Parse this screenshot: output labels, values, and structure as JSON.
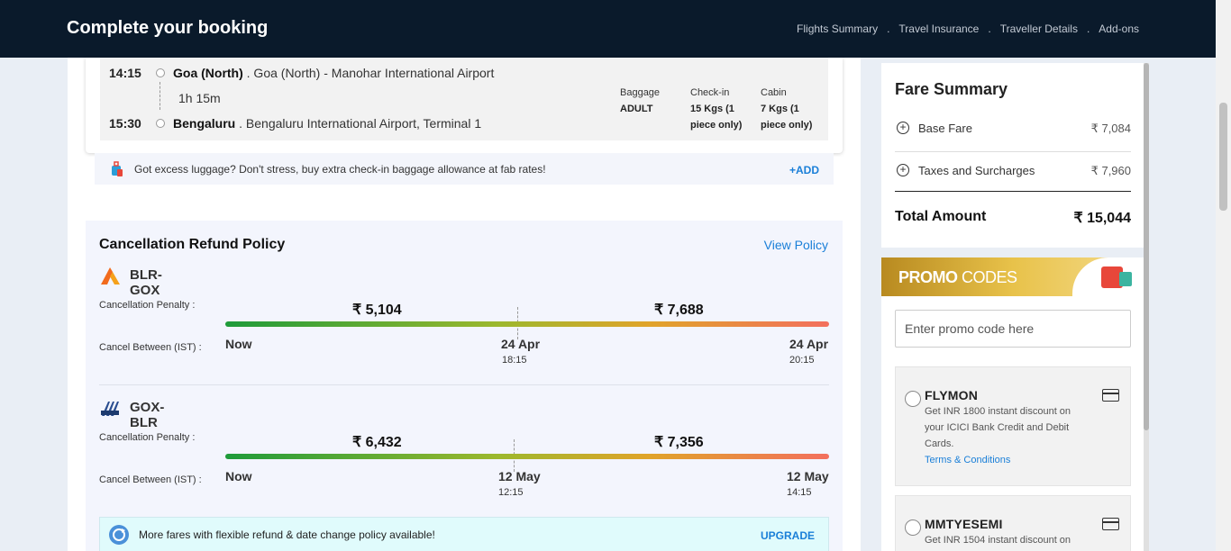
{
  "header": {
    "title": "Complete your booking",
    "steps": [
      "Flights Summary",
      "Travel Insurance",
      "Traveller Details",
      "Add-ons"
    ],
    "separator": "."
  },
  "flight": {
    "depart_time": "14:15",
    "depart_city": "Goa (North)",
    "depart_airport": ". Goa (North) - Manohar International Airport",
    "duration": "1h 15m",
    "arrive_time": "15:30",
    "arrive_city": "Bengaluru",
    "arrive_airport": ". Bengaluru International Airport, Terminal 1",
    "baggage_label": "Baggage",
    "baggage_value": "ADULT",
    "checkin_label": "Check-in",
    "checkin_value": "15 Kgs (1 piece only)",
    "cabin_label": "Cabin",
    "cabin_value": "7 Kgs (1 piece only)"
  },
  "luggage": {
    "text": "Got excess luggage? Don't stress, buy extra check-in baggage allowance at fab rates!",
    "action": "+ADD"
  },
  "cancellation": {
    "title": "Cancellation Refund Policy",
    "view_policy": "View Policy",
    "penalty_label": "Cancellation Penalty :",
    "between_label": "Cancel Between (IST) :",
    "routes": [
      {
        "code": "BLR-GOX",
        "price_1": "₹ 5,104",
        "price_2": "₹ 7,688",
        "start": "Now",
        "mid_date": "24 Apr",
        "mid_time": "18:15",
        "end_date": "24 Apr",
        "end_time": "20:15"
      },
      {
        "code": "GOX-BLR",
        "price_1": "₹ 6,432",
        "price_2": "₹ 7,356",
        "start": "Now",
        "mid_date": "12 May",
        "mid_time": "12:15",
        "end_date": "12 May",
        "end_time": "14:15"
      }
    ],
    "upgrade_text": "More fares with flexible refund & date change policy available!",
    "upgrade_action": "UPGRADE"
  },
  "fare_summary": {
    "title": "Fare Summary",
    "rows": [
      {
        "label": "Base Fare",
        "amount": "₹ 7,084"
      },
      {
        "label": "Taxes and Surcharges",
        "amount": "₹ 7,960"
      }
    ],
    "total_label": "Total Amount",
    "total_amount": "₹ 15,044"
  },
  "promo": {
    "title_bold": "PROMO",
    "title_rest": " CODES",
    "placeholder": "Enter promo code here",
    "offers": [
      {
        "code": "FLYMON",
        "desc": "Get INR 1800 instant discount on your ICICI Bank Credit and Debit Cards.",
        "terms": "Terms & Conditions"
      },
      {
        "code": "MMTYESEMI",
        "desc": "Get INR 1504 instant discount on",
        "terms": ""
      }
    ]
  },
  "colors": {
    "header_bg": "#0a1a2b",
    "accent": "#1a7fd8",
    "bar_start": "#1e9b3a",
    "bar_end": "#f36f5d"
  }
}
